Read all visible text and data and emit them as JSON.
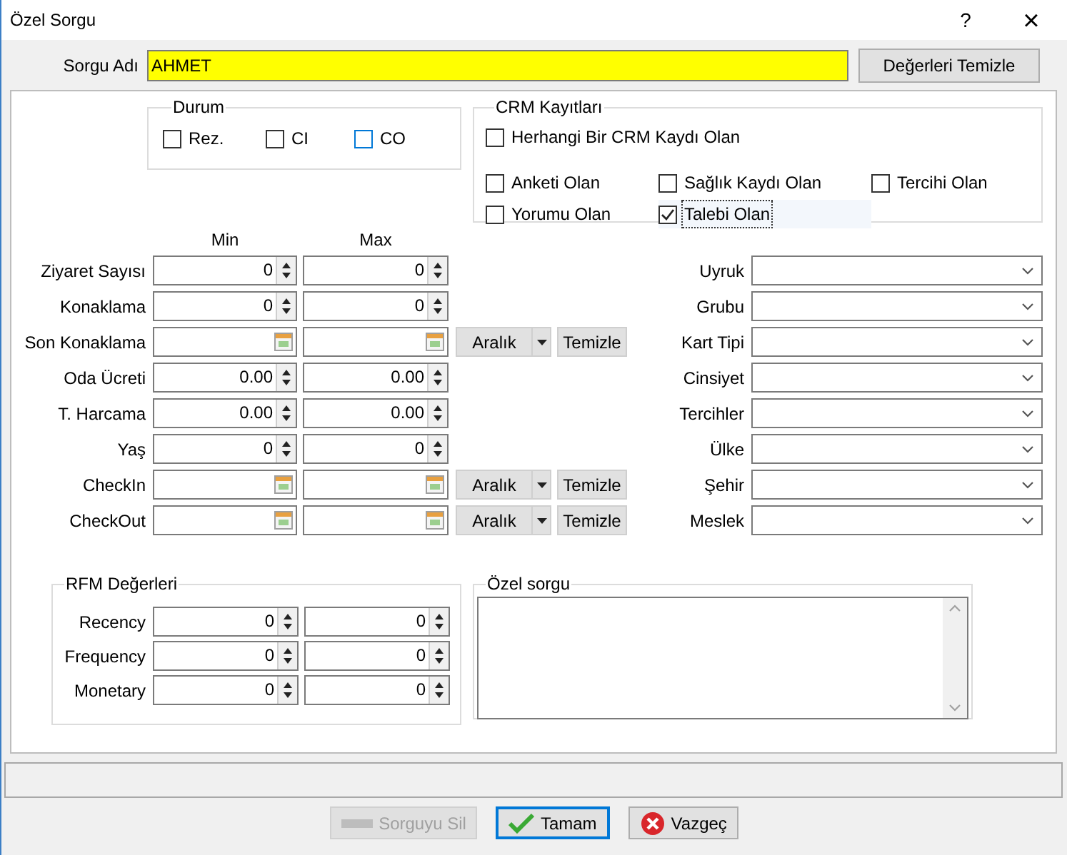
{
  "window": {
    "title": "Özel Sorgu",
    "help_button": "?",
    "close_button": "×"
  },
  "query_name": {
    "label": "Sorgu Adı",
    "value": "AHMET"
  },
  "clear_values_button": "Değerleri Temizle",
  "durum": {
    "title": "Durum",
    "items": [
      {
        "label": "Rez.",
        "checked": false,
        "highlighted": false
      },
      {
        "label": "CI",
        "checked": false,
        "highlighted": false
      },
      {
        "label": "CO",
        "checked": false,
        "highlighted": true
      }
    ]
  },
  "crm": {
    "title": "CRM Kayıtları",
    "any_record": {
      "label": "Herhangi Bir CRM Kaydı Olan",
      "checked": false,
      "focused": false
    },
    "items": [
      {
        "label": "Anketi Olan",
        "checked": false,
        "focused": false
      },
      {
        "label": "Sağlık Kaydı Olan",
        "checked": false,
        "focused": false
      },
      {
        "label": "Tercihi Olan",
        "checked": false,
        "focused": false
      },
      {
        "label": "Yorumu Olan",
        "checked": false,
        "focused": false
      },
      {
        "label": "Talebi Olan",
        "checked": true,
        "focused": true
      }
    ]
  },
  "range_headers": [
    "Min",
    "Max"
  ],
  "left_rows": [
    {
      "label": "Ziyaret Sayısı",
      "kind": "number",
      "min": "0",
      "max": "0"
    },
    {
      "label": "Konaklama",
      "kind": "number",
      "min": "0",
      "max": "0"
    },
    {
      "label": "Son Konaklama",
      "kind": "date",
      "range_button": "Aralık",
      "clear_button": "Temizle"
    },
    {
      "label": "Oda Ücreti",
      "kind": "number",
      "min": "0.00",
      "max": "0.00"
    },
    {
      "label": "T. Harcama",
      "kind": "number",
      "min": "0.00",
      "max": "0.00"
    },
    {
      "label": "Yaş",
      "kind": "number",
      "min": "0",
      "max": "0"
    },
    {
      "label": "CheckIn",
      "kind": "date",
      "range_button": "Aralık",
      "clear_button": "Temizle"
    },
    {
      "label": "CheckOut",
      "kind": "date",
      "range_button": "Aralık",
      "clear_button": "Temizle"
    }
  ],
  "right_rows": [
    {
      "label": "Uyruk"
    },
    {
      "label": "Grubu"
    },
    {
      "label": "Kart Tipi"
    },
    {
      "label": "Cinsiyet"
    },
    {
      "label": "Tercihler"
    },
    {
      "label": "Ülke"
    },
    {
      "label": "Şehir"
    },
    {
      "label": "Meslek"
    }
  ],
  "rfm": {
    "title": "RFM Değerleri",
    "rows": [
      {
        "label": "Recency",
        "min": "0",
        "max": "0"
      },
      {
        "label": "Frequency",
        "min": "0",
        "max": "0"
      },
      {
        "label": "Monetary",
        "min": "0",
        "max": "0"
      }
    ]
  },
  "custom_query": {
    "title": "Özel sorgu"
  },
  "buttons": [
    {
      "label": "Sorguyu Sil",
      "kind": "delete",
      "disabled": true,
      "focused": false
    },
    {
      "label": "Tamam",
      "kind": "ok",
      "disabled": false,
      "focused": true
    },
    {
      "label": "Vazgeç",
      "kind": "cancel",
      "disabled": false,
      "focused": false
    }
  ]
}
